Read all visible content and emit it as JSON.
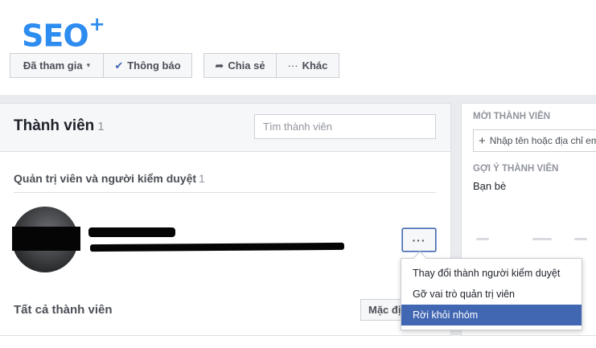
{
  "logo": {
    "text": "SEO",
    "plus": "+"
  },
  "group_actions": {
    "joined_label": "Đã tham gia",
    "joined_caret": "▾",
    "notifications_icon": "✔",
    "notifications_label": "Thông báo",
    "share_icon": "➦",
    "share_label": "Chia sẻ",
    "more_icon": "···",
    "more_label": "Khác"
  },
  "members": {
    "title": "Thành viên",
    "count": "1",
    "search_placeholder": "Tìm thành viên",
    "admins_heading": "Quản trị viên và người kiểm duyệt",
    "admins_count": "1",
    "row_more_button": "···",
    "all_members_heading": "Tất cả thành viên",
    "default_sort_label": "Mặc định"
  },
  "member_menu": {
    "items": [
      {
        "label": "Thay đổi thành người kiểm duyệt"
      },
      {
        "label": "Gỡ vai trò quản trị viên"
      },
      {
        "label": "Rời khỏi nhóm"
      }
    ],
    "highlighted_index": 2
  },
  "sidebar": {
    "new_members_heading": "MỜI THÀNH VIÊN",
    "add_member_placeholder": "Nhập tên hoặc địa chỉ email",
    "suggest_heading": "GỢI Ý THÀNH VIÊN",
    "friends_label": "Bạn bè"
  },
  "colors": {
    "brand_blue": "#4267b2",
    "logo_blue": "#2d8cf0",
    "page_bg": "#e9ebee"
  }
}
